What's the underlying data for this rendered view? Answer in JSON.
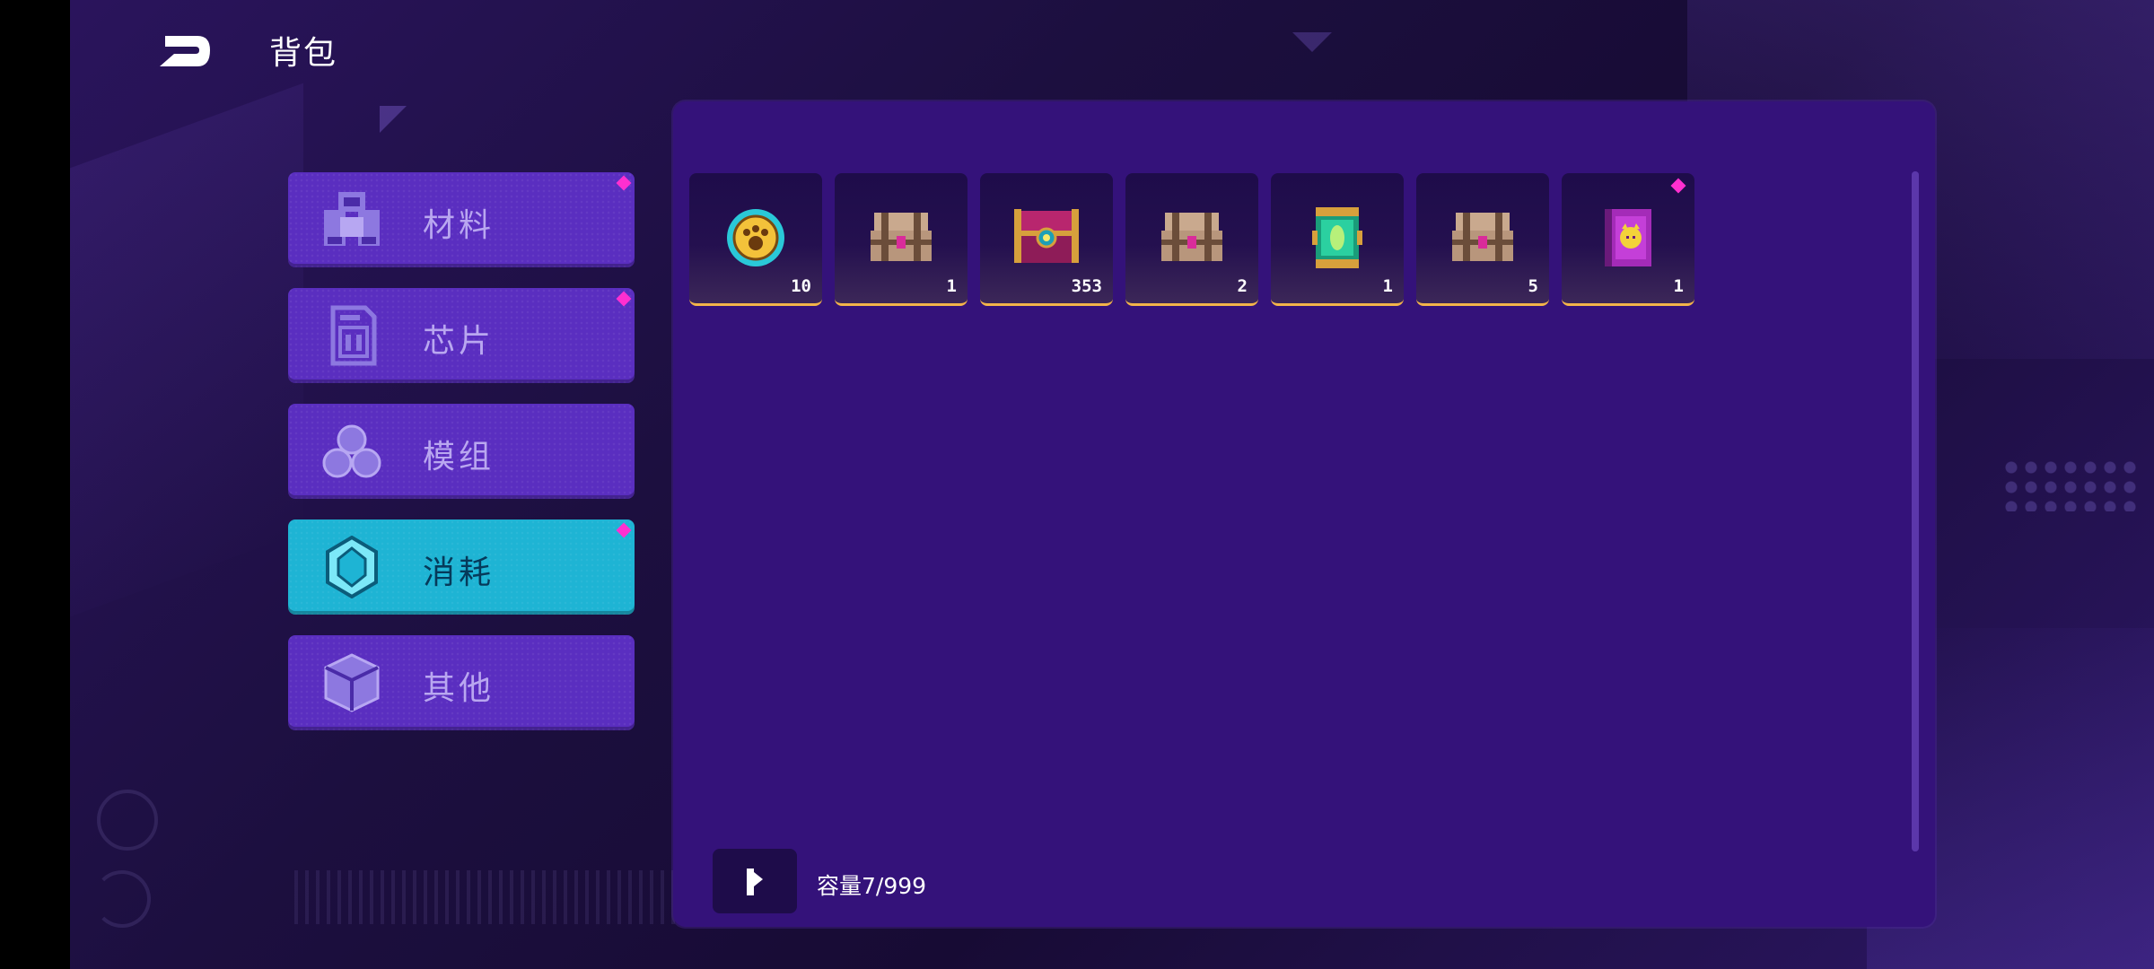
{
  "header": {
    "title": "背包",
    "back_icon": "back-arrow-icon"
  },
  "categories": [
    {
      "label": "材料",
      "icon": "materials-icon",
      "badge": true,
      "active": false
    },
    {
      "label": "芯片",
      "icon": "chip-icon",
      "badge": true,
      "active": false
    },
    {
      "label": "模组",
      "icon": "module-icon",
      "badge": false,
      "active": false
    },
    {
      "label": "消耗",
      "icon": "consumable-icon",
      "badge": true,
      "active": true
    },
    {
      "label": "其他",
      "icon": "cube-icon",
      "badge": false,
      "active": false
    }
  ],
  "items": [
    {
      "icon": "paw-coin-icon",
      "count": "10",
      "badge": false
    },
    {
      "icon": "crate-icon",
      "count": "1",
      "badge": false
    },
    {
      "icon": "treasure-chest-icon",
      "count": "353",
      "badge": false
    },
    {
      "icon": "crate-icon",
      "count": "2",
      "badge": false
    },
    {
      "icon": "capsule-icon",
      "count": "1",
      "badge": false
    },
    {
      "icon": "crate-icon",
      "count": "5",
      "badge": false
    },
    {
      "icon": "pet-book-icon",
      "count": "1",
      "badge": true
    }
  ],
  "footer": {
    "sort_icon": "sort-icon",
    "capacity": "容量7/999"
  },
  "colors": {
    "panel": "#34127a",
    "category": "#5a2ec0",
    "category_active": "#1eb4d4",
    "badge": "#ff2fd0",
    "slot_accent": "#f3b44a"
  }
}
